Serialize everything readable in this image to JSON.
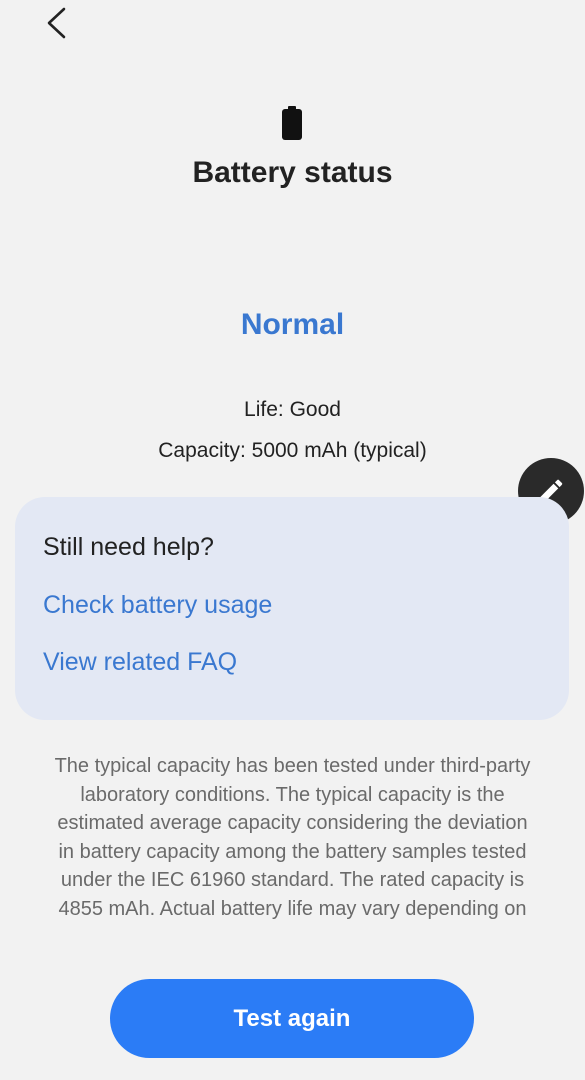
{
  "header": {
    "back_icon": "chevron-left-icon",
    "battery_icon": "battery-icon",
    "title": "Battery status"
  },
  "status": {
    "value": "Normal",
    "life": "Life: Good",
    "capacity": "Capacity: 5000 mAh (typical)"
  },
  "edit_fab": {
    "icon": "pencil-icon"
  },
  "help_card": {
    "title": "Still need help?",
    "links": [
      "Check battery usage",
      "View related FAQ"
    ]
  },
  "disclaimer": "The typical capacity has been tested under third-party laboratory conditions. The typical capacity is the estimated average capacity considering the deviation in battery capacity among the battery samples tested under the IEC 61960 standard. The rated capacity is 4855 mAh. Actual battery life may vary depending on",
  "actions": {
    "test_again": "Test again"
  },
  "colors": {
    "accent": "#3a78d0",
    "button": "#2b7cf6",
    "card": "#e3e8f4",
    "background": "#f2f2f2"
  }
}
